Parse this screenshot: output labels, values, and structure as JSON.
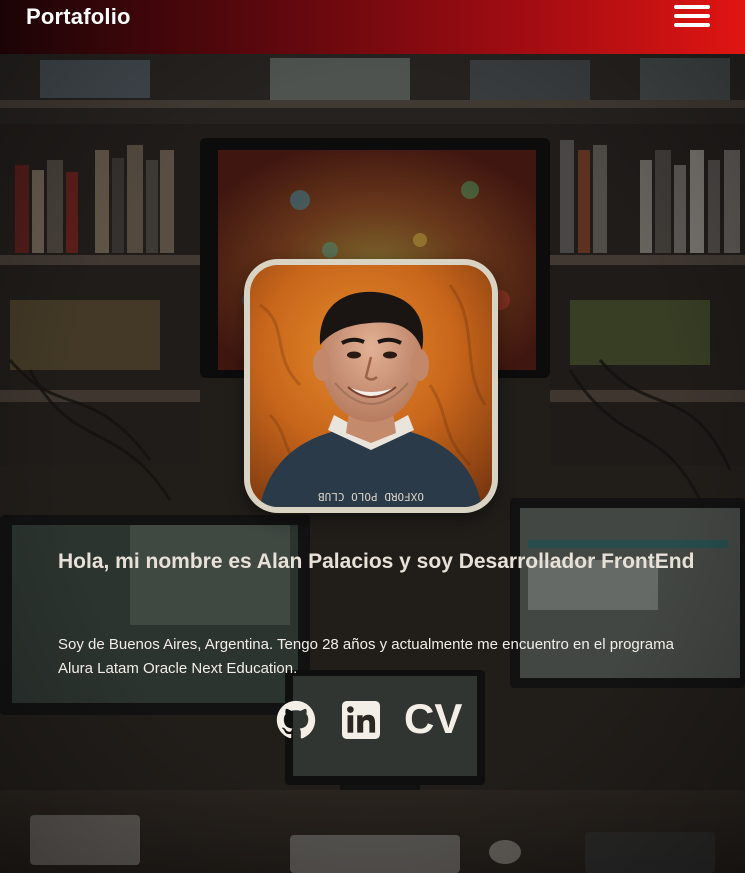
{
  "header": {
    "brand": "Portafolio",
    "menu_icon": "hamburger-menu-icon"
  },
  "hero": {
    "photo_alt": "Alan Palacios",
    "title": "Hola, mi nombre es Alan Palacios y soy Desarrollador FrontEnd",
    "description": "Soy de Buenos Aires, Argentina. Tengo 28 años y actualmente me encuentro en el programa Alura Latam Oracle Next Education.",
    "shirt_text": "OXFORD POLO CLUB"
  },
  "social": {
    "github_icon": "github-icon",
    "linkedin_icon": "linkedin-icon",
    "cv_label": "CV"
  },
  "colors": {
    "header_start": "#1b0406",
    "header_end": "#e01512",
    "text_light": "#f2ede6",
    "photo_border": "#d9d3c3"
  }
}
